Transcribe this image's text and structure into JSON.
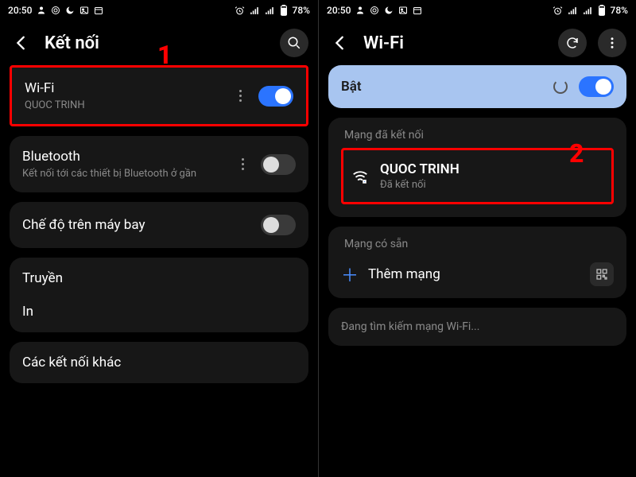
{
  "statusbar": {
    "time": "20:50",
    "battery": "78%"
  },
  "left": {
    "title": "Kết nối",
    "wifi": {
      "label": "Wi-Fi",
      "sub": "QUOC TRINH",
      "on": true
    },
    "bluetooth": {
      "label": "Bluetooth",
      "sub": "Kết nối tới các thiết bị Bluetooth ở gần",
      "on": false
    },
    "airplane": {
      "label": "Chế độ trên máy bay",
      "on": false
    },
    "cast": {
      "label": "Truyền"
    },
    "print": {
      "label": "In"
    },
    "more": {
      "label": "Các kết nối khác"
    }
  },
  "right": {
    "title": "Wi-Fi",
    "enable": {
      "label": "Bật",
      "on": true
    },
    "connected_section": "Mạng đã kết nối",
    "network": {
      "name": "QUOC TRINH",
      "status": "Đã kết nối"
    },
    "available_section": "Mạng có sẵn",
    "add": {
      "label": "Thêm mạng"
    },
    "scanning": "Đang tìm kiếm mạng Wi-Fi..."
  },
  "annotations": {
    "step1": "1",
    "step2": "2"
  }
}
